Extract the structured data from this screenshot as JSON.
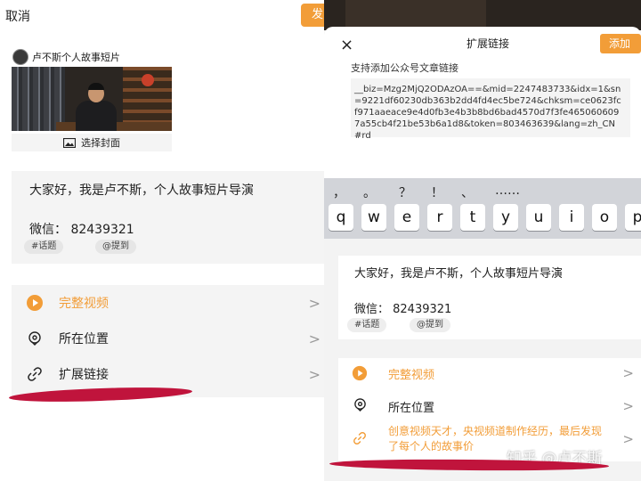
{
  "left": {
    "cancel_label": "取消",
    "publish_label": "发",
    "author_name": "卢不斯个人故事短片",
    "cover_button_label": "选择封面",
    "intro_text": "大家好，我是卢不斯，个人故事短片导演",
    "wechat_text": "微信： 82439321",
    "tags": [
      "#话题",
      "@提到"
    ],
    "menu": [
      {
        "label": "完整视频",
        "icon": "play-icon",
        "color": "#f29d38"
      },
      {
        "label": "所在位置",
        "icon": "location-icon",
        "color": "#222222"
      },
      {
        "label": "扩展链接",
        "icon": "link-icon",
        "color": "#222222"
      }
    ],
    "chevron": ">"
  },
  "right": {
    "close_icon": "×",
    "sheet_title": "扩展链接",
    "add_label": "添加",
    "hint_text": "支持添加公众号文章链接",
    "url_text": "__biz=Mzg2MjQ2ODAzOA==&mid=2247483733&idx=1&sn=9221df60230db363b2dd4fd4ec5be724&chksm=ce0623fcf971aaeace9e4d0fb3e4b3b8bd6bad4570d7f3fe4650606097a55cb4f21be53b6a1d8&token=803463639&lang=zh_CN#rd",
    "punctuation": [
      "，",
      "。",
      "？",
      "！",
      "、",
      "……"
    ],
    "keys": [
      "q",
      "w",
      "e",
      "r",
      "t",
      "y",
      "u",
      "i",
      "o",
      "p"
    ],
    "intro_text": "大家好，我是卢不斯，个人故事短片导演",
    "wechat_text": "微信： 82439321",
    "tags": [
      "#话题",
      "@提到"
    ],
    "menu": [
      {
        "label": "完整视频",
        "icon": "play-icon",
        "color": "#f29d38"
      },
      {
        "label": "所在位置",
        "icon": "location-icon",
        "color": "#222222"
      }
    ],
    "extended_link_text": "创意视频天才，央视频道制作经历，最后发现了每个人的故事价",
    "watermark": "知乎 @卢不斯",
    "chevron": ">"
  },
  "colors": {
    "accent": "#f29d38",
    "marker": "#c0143c"
  }
}
